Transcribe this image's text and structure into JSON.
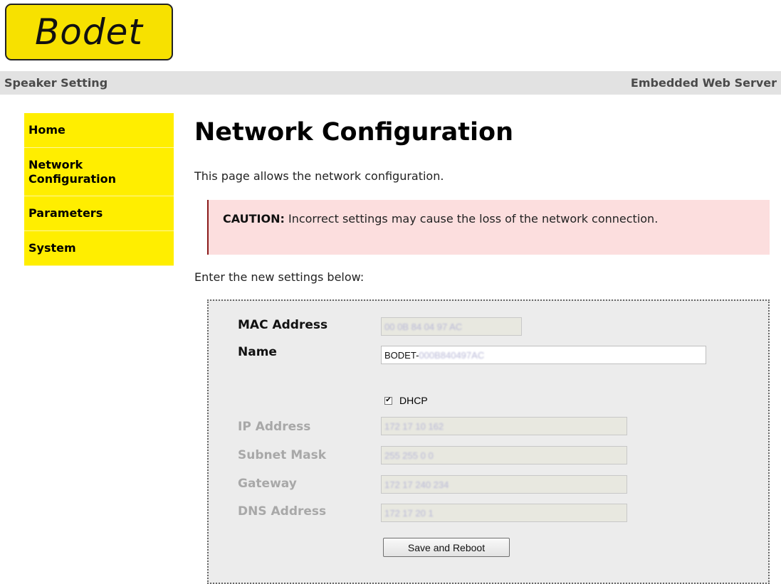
{
  "logo": {
    "text": "Bodet",
    "color": "#f7e100"
  },
  "topbar": {
    "left": "Speaker Setting",
    "right": "Embedded Web Server"
  },
  "sidebar": {
    "color": "#ffee00",
    "items": [
      {
        "label": "Home"
      },
      {
        "label": "Network Configuration"
      },
      {
        "label": "Parameters"
      },
      {
        "label": "System"
      }
    ]
  },
  "main": {
    "title": "Network Configuration",
    "intro": "This page allows the network configuration.",
    "caution_label": "CAUTION:",
    "caution_text": " Incorrect settings may cause the loss of the network connection.",
    "enter_text": "Enter the new settings below:"
  },
  "form": {
    "mac_label": "MAC Address",
    "mac_value": "00 0B 84 04 97 AC",
    "name_label": "Name",
    "name_prefix": "BODET-",
    "name_suffix": "000B840497AC",
    "dhcp_label": "DHCP",
    "dhcp_checked": true,
    "ip_label": "IP Address",
    "ip_value": "172 17 10 162",
    "subnet_label": "Subnet Mask",
    "subnet_value": "255 255 0 0",
    "gateway_label": "Gateway",
    "gateway_value": "172 17 240 234",
    "dns_label": "DNS Address",
    "dns_value": "172 17 20 1",
    "save_label": "Save and Reboot"
  }
}
